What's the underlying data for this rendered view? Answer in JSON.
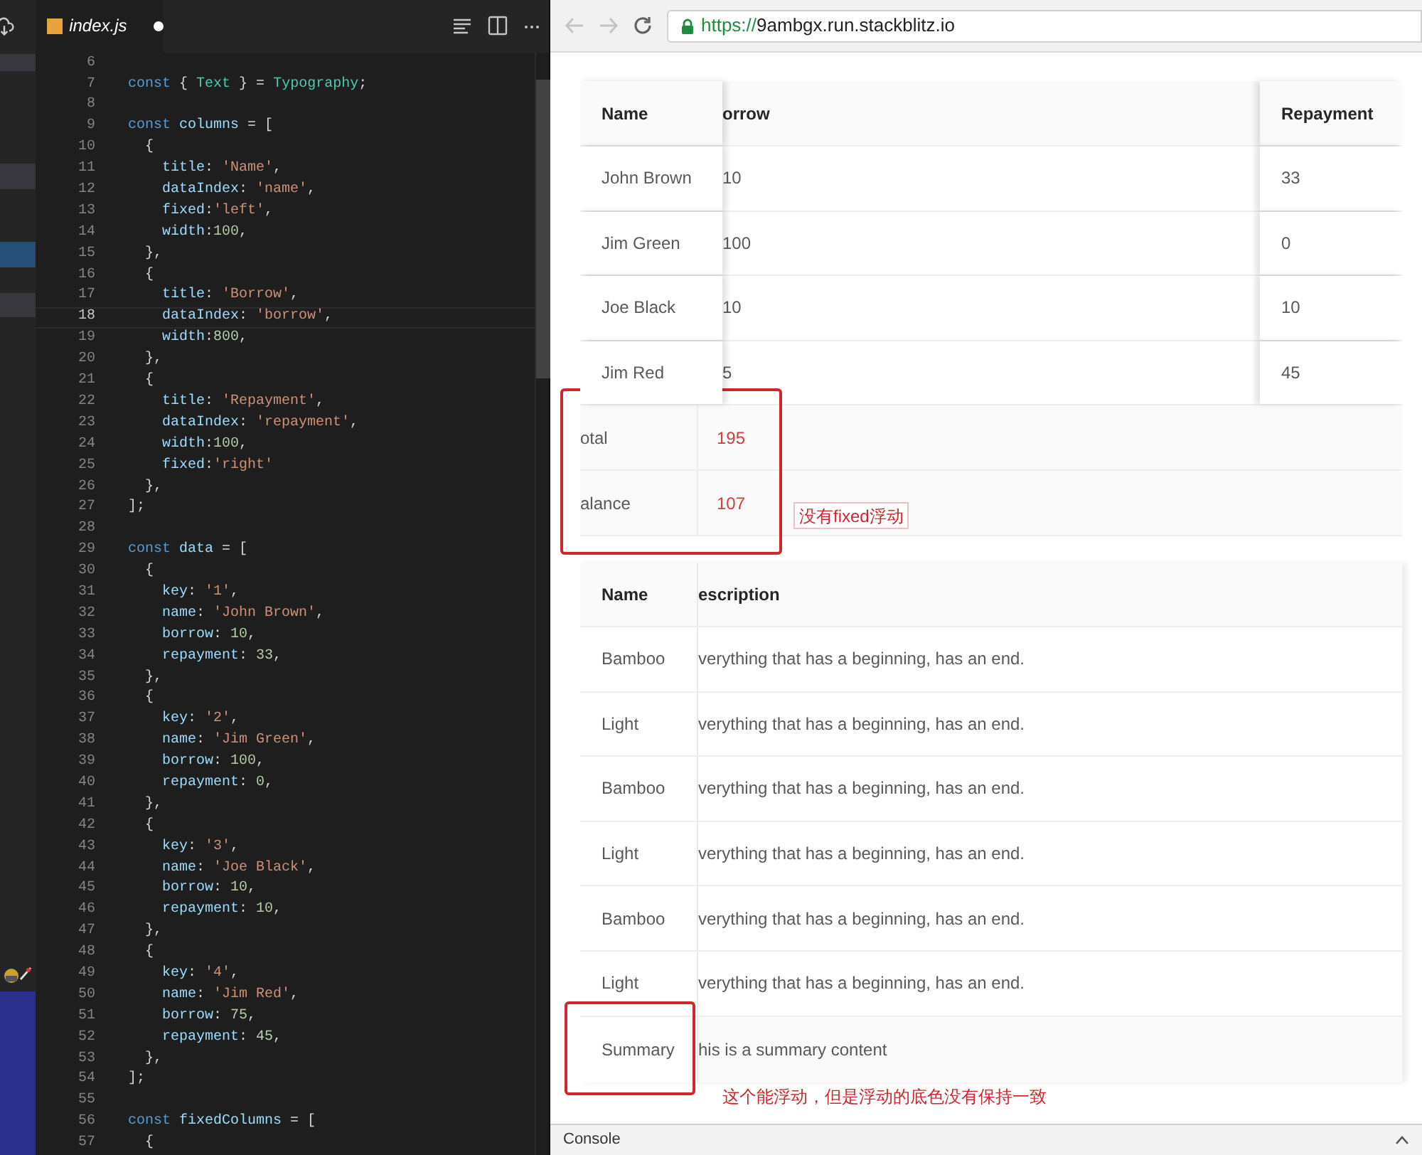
{
  "sidebar": {
    "items": [
      {
        "selected": false
      },
      {
        "selected": false
      },
      {
        "selected": true
      },
      {
        "selected": false
      }
    ]
  },
  "editor": {
    "tab": {
      "label": "index.js",
      "modified": true
    },
    "lines": [
      {
        "number": "6",
        "current": false
      },
      {
        "number": "7",
        "current": false,
        "tokens": [
          {
            "kind": "kw",
            "text": "const"
          },
          {
            "kind": "p",
            "text": " { "
          },
          {
            "kind": "type",
            "text": "Text"
          },
          {
            "kind": "p",
            "text": " } = "
          },
          {
            "kind": "type",
            "text": "Typography"
          },
          {
            "kind": "p",
            "text": ";"
          }
        ]
      },
      {
        "number": "8",
        "current": false
      },
      {
        "number": "9",
        "current": false,
        "tokens": [
          {
            "kind": "kw",
            "text": "const"
          },
          {
            "kind": "var",
            "text": " columns"
          },
          {
            "kind": "p",
            "text": " = ["
          }
        ]
      },
      {
        "number": "10",
        "current": false,
        "tokens": [
          {
            "kind": "p",
            "text": "  {"
          }
        ]
      },
      {
        "number": "11",
        "current": false,
        "tokens": [
          {
            "kind": "prop",
            "text": "    title"
          },
          {
            "kind": "p",
            "text": ": "
          },
          {
            "kind": "str",
            "text": "'Name'"
          },
          {
            "kind": "p",
            "text": ","
          }
        ]
      },
      {
        "number": "12",
        "current": false,
        "tokens": [
          {
            "kind": "prop",
            "text": "    dataIndex"
          },
          {
            "kind": "p",
            "text": ": "
          },
          {
            "kind": "str",
            "text": "'name'"
          },
          {
            "kind": "p",
            "text": ","
          }
        ]
      },
      {
        "number": "13",
        "current": false,
        "tokens": [
          {
            "kind": "prop",
            "text": "    fixed"
          },
          {
            "kind": "p",
            "text": ":"
          },
          {
            "kind": "str",
            "text": "'left'"
          },
          {
            "kind": "p",
            "text": ","
          }
        ]
      },
      {
        "number": "14",
        "current": false,
        "tokens": [
          {
            "kind": "prop",
            "text": "    width"
          },
          {
            "kind": "p",
            "text": ":"
          },
          {
            "kind": "num",
            "text": "100"
          },
          {
            "kind": "p",
            "text": ","
          }
        ]
      },
      {
        "number": "15",
        "current": false,
        "tokens": [
          {
            "kind": "p",
            "text": "  },"
          }
        ]
      },
      {
        "number": "16",
        "current": false,
        "tokens": [
          {
            "kind": "p",
            "text": "  {"
          }
        ]
      },
      {
        "number": "17",
        "current": false,
        "tokens": [
          {
            "kind": "prop",
            "text": "    title"
          },
          {
            "kind": "p",
            "text": ": "
          },
          {
            "kind": "str",
            "text": "'Borrow'"
          },
          {
            "kind": "p",
            "text": ","
          }
        ]
      },
      {
        "number": "18",
        "current": true,
        "tokens": [
          {
            "kind": "prop",
            "text": "    dataIndex"
          },
          {
            "kind": "p",
            "text": ": "
          },
          {
            "kind": "str",
            "text": "'borrow'"
          },
          {
            "kind": "p",
            "text": ","
          }
        ]
      },
      {
        "number": "19",
        "current": false,
        "tokens": [
          {
            "kind": "prop",
            "text": "    width"
          },
          {
            "kind": "p",
            "text": ":"
          },
          {
            "kind": "num",
            "text": "800"
          },
          {
            "kind": "p",
            "text": ","
          }
        ]
      },
      {
        "number": "20",
        "current": false,
        "tokens": [
          {
            "kind": "p",
            "text": "  },"
          }
        ]
      },
      {
        "number": "21",
        "current": false,
        "tokens": [
          {
            "kind": "p",
            "text": "  {"
          }
        ]
      },
      {
        "number": "22",
        "current": false,
        "tokens": [
          {
            "kind": "prop",
            "text": "    title"
          },
          {
            "kind": "p",
            "text": ": "
          },
          {
            "kind": "str",
            "text": "'Repayment'"
          },
          {
            "kind": "p",
            "text": ","
          }
        ]
      },
      {
        "number": "23",
        "current": false,
        "tokens": [
          {
            "kind": "prop",
            "text": "    dataIndex"
          },
          {
            "kind": "p",
            "text": ": "
          },
          {
            "kind": "str",
            "text": "'repayment'"
          },
          {
            "kind": "p",
            "text": ","
          }
        ]
      },
      {
        "number": "24",
        "current": false,
        "tokens": [
          {
            "kind": "prop",
            "text": "    width"
          },
          {
            "kind": "p",
            "text": ":"
          },
          {
            "kind": "num",
            "text": "100"
          },
          {
            "kind": "p",
            "text": ","
          }
        ]
      },
      {
        "number": "25",
        "current": false,
        "tokens": [
          {
            "kind": "prop",
            "text": "    fixed"
          },
          {
            "kind": "p",
            "text": ":"
          },
          {
            "kind": "str",
            "text": "'right'"
          }
        ]
      },
      {
        "number": "26",
        "current": false,
        "tokens": [
          {
            "kind": "p",
            "text": "  },"
          }
        ]
      },
      {
        "number": "27",
        "current": false,
        "tokens": [
          {
            "kind": "p",
            "text": "];"
          }
        ]
      },
      {
        "number": "28",
        "current": false
      },
      {
        "number": "29",
        "current": false,
        "tokens": [
          {
            "kind": "kw",
            "text": "const"
          },
          {
            "kind": "var",
            "text": " data"
          },
          {
            "kind": "p",
            "text": " = ["
          }
        ]
      },
      {
        "number": "30",
        "current": false,
        "tokens": [
          {
            "kind": "p",
            "text": "  {"
          }
        ]
      },
      {
        "number": "31",
        "current": false,
        "tokens": [
          {
            "kind": "prop",
            "text": "    key"
          },
          {
            "kind": "p",
            "text": ": "
          },
          {
            "kind": "str",
            "text": "'1'"
          },
          {
            "kind": "p",
            "text": ","
          }
        ]
      },
      {
        "number": "32",
        "current": false,
        "tokens": [
          {
            "kind": "prop",
            "text": "    name"
          },
          {
            "kind": "p",
            "text": ": "
          },
          {
            "kind": "str",
            "text": "'John Brown'"
          },
          {
            "kind": "p",
            "text": ","
          }
        ]
      },
      {
        "number": "33",
        "current": false,
        "tokens": [
          {
            "kind": "prop",
            "text": "    borrow"
          },
          {
            "kind": "p",
            "text": ": "
          },
          {
            "kind": "num",
            "text": "10"
          },
          {
            "kind": "p",
            "text": ","
          }
        ]
      },
      {
        "number": "34",
        "current": false,
        "tokens": [
          {
            "kind": "prop",
            "text": "    repayment"
          },
          {
            "kind": "p",
            "text": ": "
          },
          {
            "kind": "num",
            "text": "33"
          },
          {
            "kind": "p",
            "text": ","
          }
        ]
      },
      {
        "number": "35",
        "current": false,
        "tokens": [
          {
            "kind": "p",
            "text": "  },"
          }
        ]
      },
      {
        "number": "36",
        "current": false,
        "tokens": [
          {
            "kind": "p",
            "text": "  {"
          }
        ]
      },
      {
        "number": "37",
        "current": false,
        "tokens": [
          {
            "kind": "prop",
            "text": "    key"
          },
          {
            "kind": "p",
            "text": ": "
          },
          {
            "kind": "str",
            "text": "'2'"
          },
          {
            "kind": "p",
            "text": ","
          }
        ]
      },
      {
        "number": "38",
        "current": false,
        "tokens": [
          {
            "kind": "prop",
            "text": "    name"
          },
          {
            "kind": "p",
            "text": ": "
          },
          {
            "kind": "str",
            "text": "'Jim Green'"
          },
          {
            "kind": "p",
            "text": ","
          }
        ]
      },
      {
        "number": "39",
        "current": false,
        "tokens": [
          {
            "kind": "prop",
            "text": "    borrow"
          },
          {
            "kind": "p",
            "text": ": "
          },
          {
            "kind": "num",
            "text": "100"
          },
          {
            "kind": "p",
            "text": ","
          }
        ]
      },
      {
        "number": "40",
        "current": false,
        "tokens": [
          {
            "kind": "prop",
            "text": "    repayment"
          },
          {
            "kind": "p",
            "text": ": "
          },
          {
            "kind": "num",
            "text": "0"
          },
          {
            "kind": "p",
            "text": ","
          }
        ]
      },
      {
        "number": "41",
        "current": false,
        "tokens": [
          {
            "kind": "p",
            "text": "  },"
          }
        ]
      },
      {
        "number": "42",
        "current": false,
        "tokens": [
          {
            "kind": "p",
            "text": "  {"
          }
        ]
      },
      {
        "number": "43",
        "current": false,
        "tokens": [
          {
            "kind": "prop",
            "text": "    key"
          },
          {
            "kind": "p",
            "text": ": "
          },
          {
            "kind": "str",
            "text": "'3'"
          },
          {
            "kind": "p",
            "text": ","
          }
        ]
      },
      {
        "number": "44",
        "current": false,
        "tokens": [
          {
            "kind": "prop",
            "text": "    name"
          },
          {
            "kind": "p",
            "text": ": "
          },
          {
            "kind": "str",
            "text": "'Joe Black'"
          },
          {
            "kind": "p",
            "text": ","
          }
        ]
      },
      {
        "number": "45",
        "current": false,
        "tokens": [
          {
            "kind": "prop",
            "text": "    borrow"
          },
          {
            "kind": "p",
            "text": ": "
          },
          {
            "kind": "num",
            "text": "10"
          },
          {
            "kind": "p",
            "text": ","
          }
        ]
      },
      {
        "number": "46",
        "current": false,
        "tokens": [
          {
            "kind": "prop",
            "text": "    repayment"
          },
          {
            "kind": "p",
            "text": ": "
          },
          {
            "kind": "num",
            "text": "10"
          },
          {
            "kind": "p",
            "text": ","
          }
        ]
      },
      {
        "number": "47",
        "current": false,
        "tokens": [
          {
            "kind": "p",
            "text": "  },"
          }
        ]
      },
      {
        "number": "48",
        "current": false,
        "tokens": [
          {
            "kind": "p",
            "text": "  {"
          }
        ]
      },
      {
        "number": "49",
        "current": false,
        "tokens": [
          {
            "kind": "prop",
            "text": "    key"
          },
          {
            "kind": "p",
            "text": ": "
          },
          {
            "kind": "str",
            "text": "'4'"
          },
          {
            "kind": "p",
            "text": ","
          }
        ]
      },
      {
        "number": "50",
        "current": false,
        "tokens": [
          {
            "kind": "prop",
            "text": "    name"
          },
          {
            "kind": "p",
            "text": ": "
          },
          {
            "kind": "str",
            "text": "'Jim Red'"
          },
          {
            "kind": "p",
            "text": ","
          }
        ]
      },
      {
        "number": "51",
        "current": false,
        "tokens": [
          {
            "kind": "prop",
            "text": "    borrow"
          },
          {
            "kind": "p",
            "text": ": "
          },
          {
            "kind": "num",
            "text": "75"
          },
          {
            "kind": "p",
            "text": ","
          }
        ]
      },
      {
        "number": "52",
        "current": false,
        "tokens": [
          {
            "kind": "prop",
            "text": "    repayment"
          },
          {
            "kind": "p",
            "text": ": "
          },
          {
            "kind": "num",
            "text": "45"
          },
          {
            "kind": "p",
            "text": ","
          }
        ]
      },
      {
        "number": "53",
        "current": false,
        "tokens": [
          {
            "kind": "p",
            "text": "  },"
          }
        ]
      },
      {
        "number": "54",
        "current": false,
        "tokens": [
          {
            "kind": "p",
            "text": "];"
          }
        ]
      },
      {
        "number": "55",
        "current": false
      },
      {
        "number": "56",
        "current": false,
        "tokens": [
          {
            "kind": "kw",
            "text": "const"
          },
          {
            "kind": "var",
            "text": " fixedColumns"
          },
          {
            "kind": "p",
            "text": " = ["
          }
        ]
      },
      {
        "number": "57",
        "current": false,
        "tokens": [
          {
            "kind": "p",
            "text": "  {"
          }
        ]
      }
    ]
  },
  "browser": {
    "url_scheme": "https://",
    "url_host": "9ambgx.run.stackblitz.io",
    "table_1": {
      "columns": [
        "Name",
        "orrow",
        "Repayment"
      ],
      "rows": [
        [
          "John Brown",
          "10",
          "33"
        ],
        [
          "Jim Green",
          "100",
          "0"
        ],
        [
          "Joe Black",
          "10",
          "10"
        ],
        [
          "Jim Red",
          "5",
          "45"
        ]
      ],
      "summary_rows": [
        [
          "otal",
          "195"
        ],
        [
          "alance",
          "107"
        ]
      ]
    },
    "note_1": "没有fixed浮动",
    "table_2": {
      "columns": [
        "Name",
        "escription"
      ],
      "rows": [
        [
          "Bamboo",
          "verything that has a beginning, has an end."
        ],
        [
          "Light",
          "verything that has a beginning, has an end."
        ],
        [
          "Bamboo",
          "verything that has a beginning, has an end."
        ],
        [
          "Light",
          "verything that has a beginning, has an end."
        ],
        [
          "Bamboo",
          "verything that has a beginning, has an end."
        ],
        [
          "Light",
          "verything that has a beginning, has an end."
        ]
      ],
      "summary": [
        "Summary",
        "his is a summary content"
      ]
    },
    "note_2": "这个能浮动，但是浮动的底色没有保持一致",
    "console": "Console"
  }
}
